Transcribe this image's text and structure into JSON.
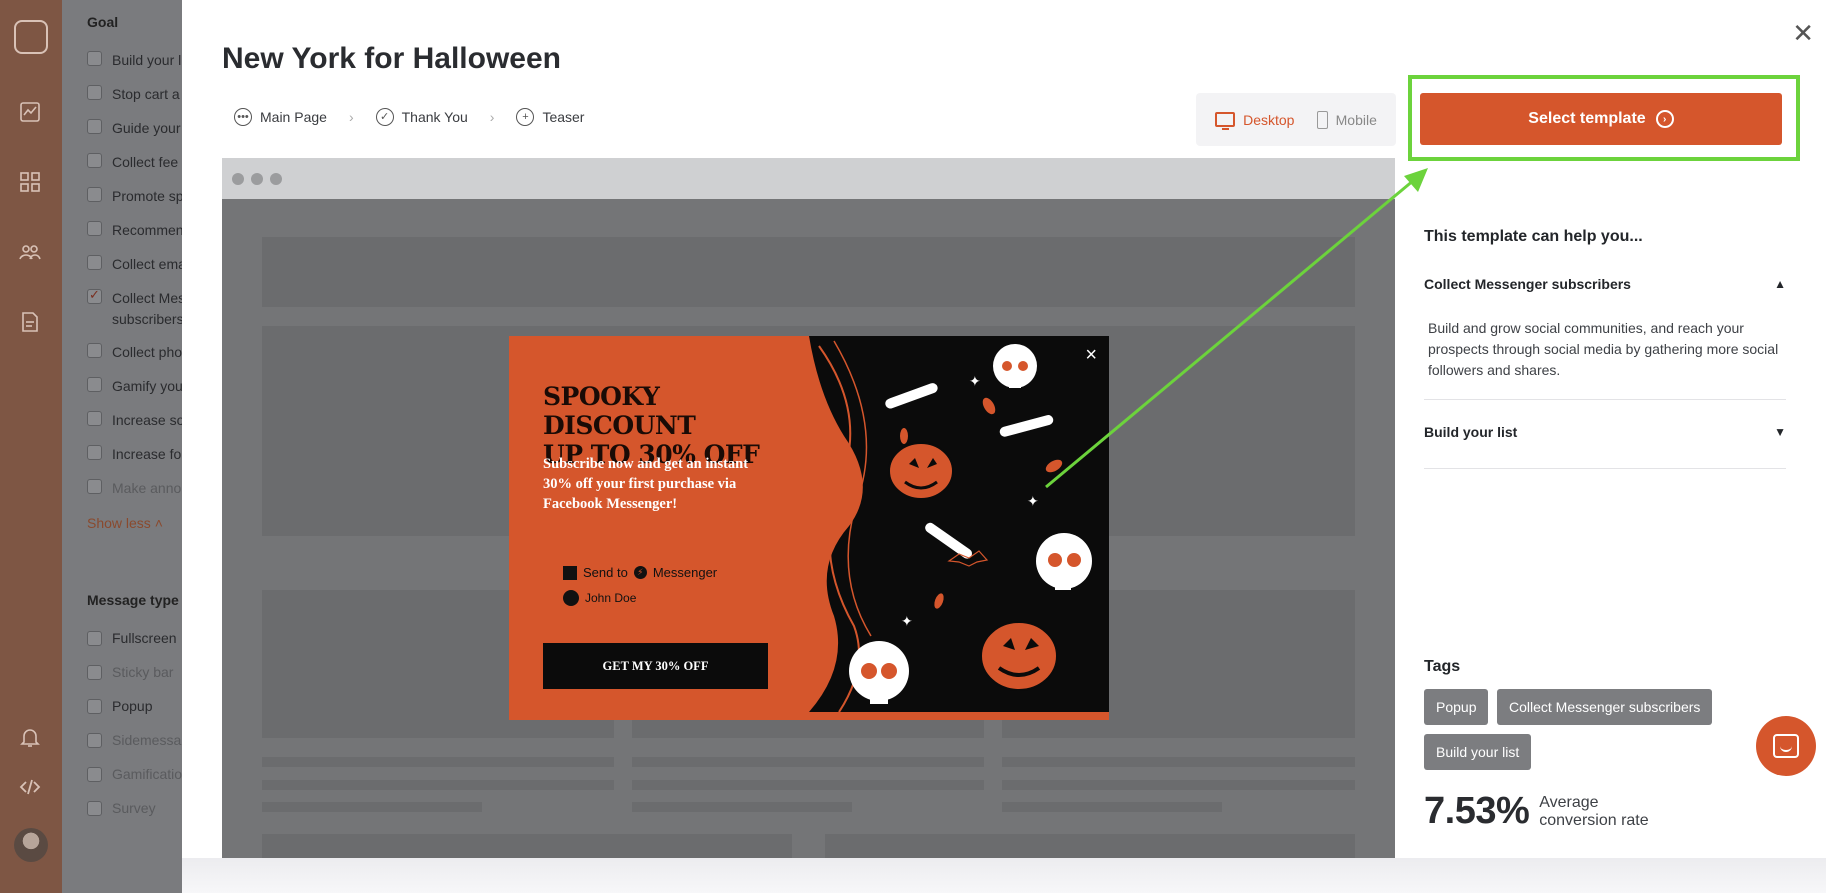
{
  "filters": {
    "goal_heading": "Goal",
    "goal_items": [
      {
        "label": "Build your l",
        "checked": false,
        "dim": false
      },
      {
        "label": "Stop cart a",
        "checked": false,
        "dim": false
      },
      {
        "label": "Guide your",
        "checked": false,
        "dim": false
      },
      {
        "label": "Collect fee",
        "checked": false,
        "dim": false
      },
      {
        "label": "Promote sp",
        "checked": false,
        "dim": false
      },
      {
        "label": "Recommen",
        "checked": false,
        "dim": false
      },
      {
        "label": "Collect ema",
        "checked": false,
        "dim": false
      },
      {
        "label": "Collect Mes",
        "label2": "subscribers",
        "checked": true,
        "dim": false
      },
      {
        "label": "Collect pho",
        "checked": false,
        "dim": false
      },
      {
        "label": "Gamify you",
        "checked": false,
        "dim": false
      },
      {
        "label": "Increase so",
        "checked": false,
        "dim": false
      },
      {
        "label": "Increase fo",
        "checked": false,
        "dim": false
      },
      {
        "label": "Make anno",
        "checked": false,
        "dim": true
      }
    ],
    "show_less": "Show less",
    "message_type_heading": "Message type",
    "message_items": [
      {
        "label": "Fullscreen",
        "dim": false
      },
      {
        "label": "Sticky bar",
        "dim": true
      },
      {
        "label": "Popup",
        "dim": false
      },
      {
        "label": "Sidemessa",
        "dim": true
      },
      {
        "label": "Gamificatio",
        "dim": true
      },
      {
        "label": "Survey",
        "dim": true
      }
    ]
  },
  "modal": {
    "title": "New York for Halloween",
    "close_glyph": "✕",
    "steps": [
      "Main Page",
      "Thank You",
      "Teaser"
    ],
    "step_separator": "›",
    "device": {
      "desktop": "Desktop",
      "mobile": "Mobile",
      "active": "desktop"
    },
    "select_button": "Select template"
  },
  "popup": {
    "headline_1": "SPOOKY DISCOUNT",
    "headline_2": "UP TO 30% OFF",
    "body": "Subscribe now and get an instant 30% off your first purchase via Facebook Messenger!",
    "send_to_prefix": "Send to",
    "send_to_suffix": "Messenger",
    "user_name": "John Doe",
    "cta": "GET MY 30% OFF",
    "close_glyph": "×",
    "colors": {
      "accent": "#d5562c",
      "dark": "#0b0b0b"
    }
  },
  "info": {
    "heading": "This template can help you...",
    "accordion": [
      {
        "title": "Collect Messenger subscribers",
        "expanded": true,
        "body": "Build and grow social communities, and reach your prospects through social media by gathering more social followers and shares."
      },
      {
        "title": "Build your list",
        "expanded": false
      }
    ],
    "tags_heading": "Tags",
    "tags": [
      "Popup",
      "Collect Messenger subscribers",
      "Build your list"
    ],
    "conversion_value": "7.53%",
    "conversion_label_1": "Average",
    "conversion_label_2": "conversion rate"
  },
  "colors": {
    "brand": "#d5562c",
    "highlight": "#6cd33c",
    "rail": "#7e5644"
  }
}
